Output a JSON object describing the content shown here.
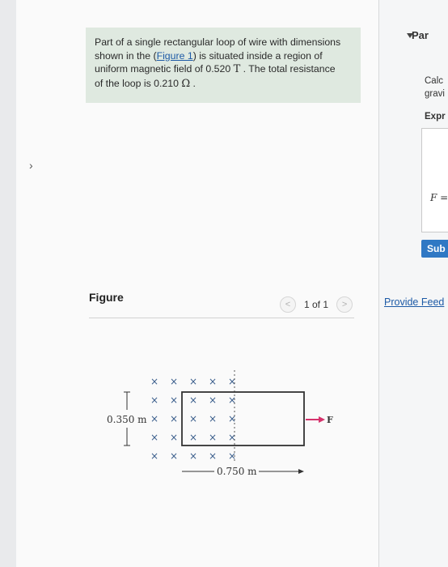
{
  "problem": {
    "line1": "Part of a single rectangular loop of wire with dimensions",
    "line2a": "shown in the (",
    "figure_link": "Figure 1",
    "line2b": ") is situated inside a region of",
    "line3a": "uniform magnetic field of 0.520",
    "unit_T": "T",
    "line3b": ". The total resistance",
    "line4a": "of the loop is 0.210",
    "unit_ohm": "Ω",
    "line4b": "."
  },
  "figure": {
    "title": "Figure",
    "pager_text": "1 of 1",
    "prev_icon": "chevron-left-icon",
    "next_icon": "chevron-right-icon",
    "height_label": "0.350 m",
    "width_label": "0.750 m",
    "force_label": "F",
    "colors": {
      "x_marks": "#3b5e8c",
      "force_arrow": "#d6336c",
      "loop": "#333333"
    }
  },
  "right_panel": {
    "part_label": "Par",
    "calc_line1": "Calc",
    "calc_line2": "gravi",
    "expr_label": "Expr",
    "answer_var": "F =",
    "submit_label": "Sub",
    "feedback_link": "Provide Feed",
    "colors": {
      "submit_bg": "#2f78c4",
      "link": "#1d5aa6"
    }
  },
  "gutter": {
    "chevron_icon": "chevron-right-icon"
  }
}
